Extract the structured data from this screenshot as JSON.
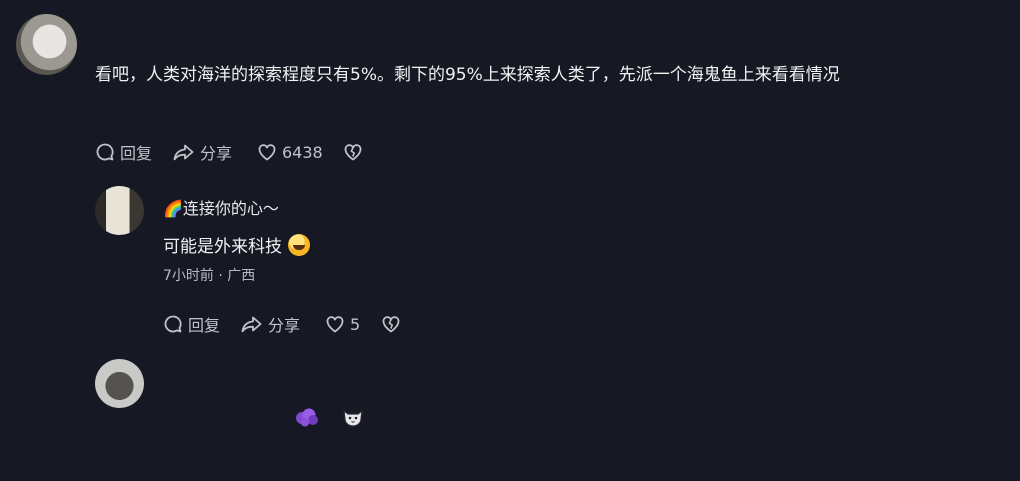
{
  "comment1": {
    "text": "看吧，人类对海洋的探索程度只有5%。剩下的95%上来探索人类了，先派一个海鬼鱼上来看看情况",
    "actions": {
      "reply_label": "回复",
      "share_label": "分享",
      "like_count": "6438"
    }
  },
  "reply1": {
    "username": "连接你的心～",
    "username_emoji": "🌈",
    "text": "可能是外来科技",
    "meta": "7小时前 · 广西",
    "actions": {
      "reply_label": "回复",
      "share_label": "分享",
      "like_count": "5"
    }
  },
  "comment3": {
    "stickers": [
      "purple-blob-sticker",
      "cat-face-sticker"
    ]
  },
  "icons": [
    "reply-icon",
    "share-icon",
    "heart-icon",
    "broken-heart-icon",
    "rainbow-icon",
    "grin-emoji-icon"
  ],
  "colors": {
    "background": "#161823",
    "text_primary": "#f2f2f3",
    "text_secondary": "#b9b9c0"
  }
}
